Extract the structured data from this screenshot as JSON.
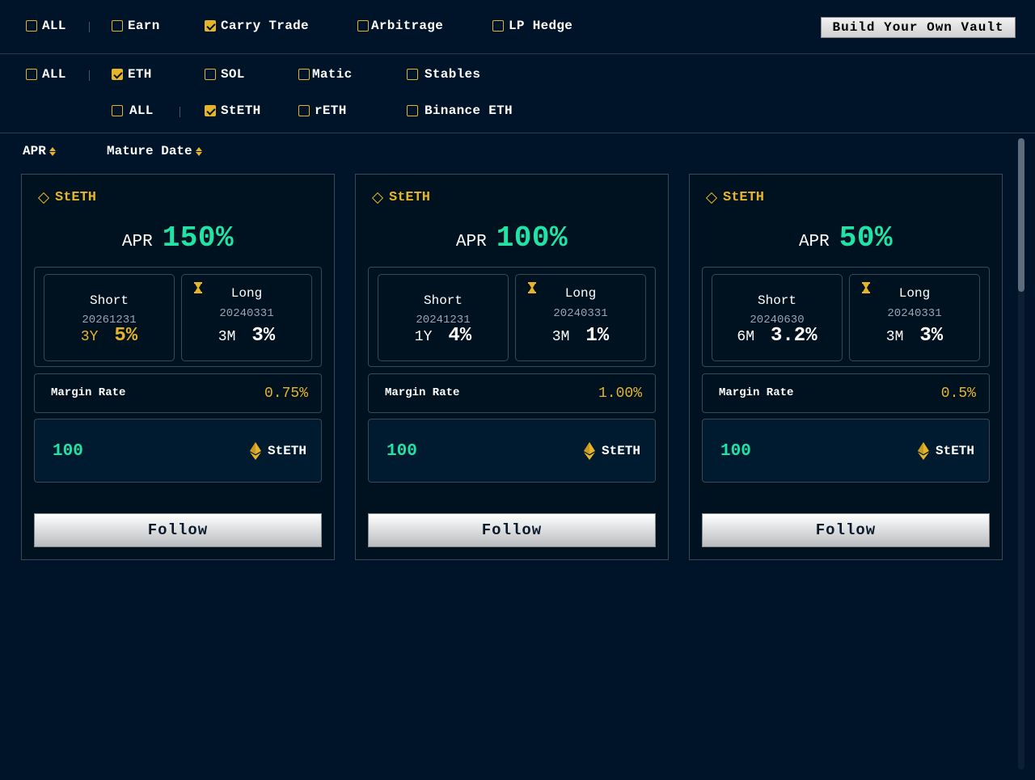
{
  "strategy_filters": [
    {
      "label": "ALL",
      "checked": false
    },
    {
      "label": "Earn",
      "checked": false
    },
    {
      "label": "Carry Trade",
      "checked": true
    },
    {
      "label": "Arbitrage",
      "checked": false
    },
    {
      "label": "LP Hedge",
      "checked": false
    }
  ],
  "build_button": "Build Your Own Vault",
  "asset_filters": [
    {
      "label": "ALL",
      "checked": false
    },
    {
      "label": "ETH",
      "checked": true
    },
    {
      "label": "SOL",
      "checked": false
    },
    {
      "label": "Matic",
      "checked": false
    },
    {
      "label": "Stables",
      "checked": false
    }
  ],
  "sub_asset_filters": [
    {
      "label": "ALL",
      "checked": false
    },
    {
      "label": "StETH",
      "checked": true
    },
    {
      "label": "rETH",
      "checked": false
    },
    {
      "label": "Binance ETH",
      "checked": false
    }
  ],
  "sort": {
    "apr_label": "APR",
    "mature_label": "Mature Date"
  },
  "accent_color": "#e6b429",
  "positive_color": "#21e3a6",
  "cards": [
    {
      "asset": "StETH",
      "apr_label": "APR",
      "apr": "150%",
      "short": {
        "title": "Short",
        "date": "20261231",
        "tenor": "3Y",
        "rate": "5%"
      },
      "long": {
        "title": "Long",
        "date": "20240331",
        "tenor": "3M",
        "rate": "3%"
      },
      "margin_label": "Margin Rate",
      "margin_rate": "0.75%",
      "amount": "100",
      "token": "StETH",
      "button": "Follow"
    },
    {
      "asset": "StETH",
      "apr_label": "APR",
      "apr": "100%",
      "short": {
        "title": "Short",
        "date": "20241231",
        "tenor": "1Y",
        "rate": "4%"
      },
      "long": {
        "title": "Long",
        "date": "20240331",
        "tenor": "3M",
        "rate": "1%"
      },
      "margin_label": "Margin Rate",
      "margin_rate": "1.00%",
      "amount": "100",
      "token": "StETH",
      "button": "Follow"
    },
    {
      "asset": "StETH",
      "apr_label": "APR",
      "apr": "50%",
      "short": {
        "title": "Short",
        "date": "20240630",
        "tenor": "6M",
        "rate": "3.2%"
      },
      "long": {
        "title": "Long",
        "date": "20240331",
        "tenor": "3M",
        "rate": "3%"
      },
      "margin_label": "Margin Rate",
      "margin_rate": "0.5%",
      "amount": "100",
      "token": "StETH",
      "button": "Follow"
    }
  ]
}
